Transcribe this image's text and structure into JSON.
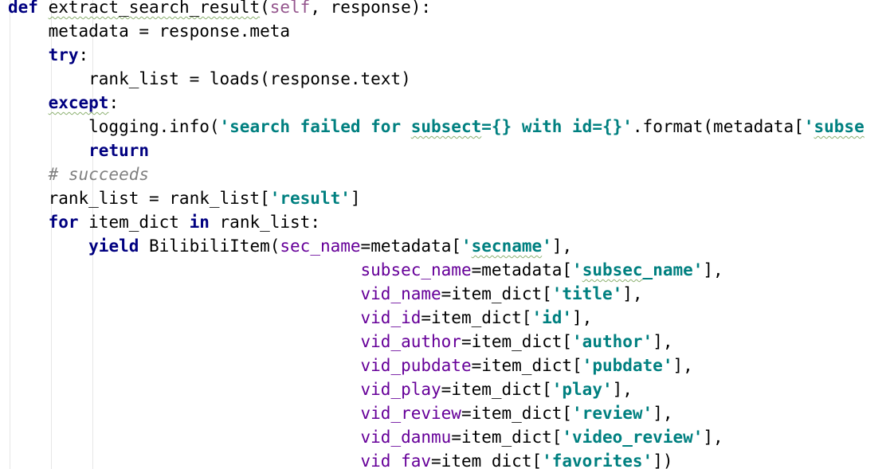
{
  "editor": {
    "language": "Python",
    "colors": {
      "keyword": "#000080",
      "self": "#94558d",
      "kwarg": "#660099",
      "string": "#008080",
      "comment": "#808080",
      "background": "#ffffff"
    },
    "lines": [
      [
        {
          "t": "def ",
          "c": "kw"
        },
        {
          "t": "extract_search_result",
          "c": "squig"
        },
        {
          "t": "("
        },
        {
          "t": "self",
          "c": "self"
        },
        {
          "t": ", response):"
        }
      ],
      [
        {
          "t": "    metadata = response.meta"
        }
      ],
      [
        {
          "t": "    "
        },
        {
          "t": "try",
          "c": "kw"
        },
        {
          "t": ":"
        }
      ],
      [
        {
          "t": "        rank_list = loads(response.text)"
        }
      ],
      [
        {
          "t": "    "
        },
        {
          "t": "except",
          "c": "kw squig"
        },
        {
          "t": ":"
        }
      ],
      [
        {
          "t": "        logging.info("
        },
        {
          "t": "'search failed for ",
          "c": "str"
        },
        {
          "t": "subsect",
          "c": "str squig"
        },
        {
          "t": "={} with id={}'",
          "c": "str"
        },
        {
          "t": ".format(metadata["
        },
        {
          "t": "'",
          "c": "str"
        },
        {
          "t": "subse",
          "c": "str squig"
        }
      ],
      [
        {
          "t": "        "
        },
        {
          "t": "return",
          "c": "kw"
        }
      ],
      [
        {
          "t": "    "
        },
        {
          "t": "# succeeds",
          "c": "cmt"
        }
      ],
      [
        {
          "t": "    rank_list = rank_list["
        },
        {
          "t": "'result'",
          "c": "str"
        },
        {
          "t": "]"
        }
      ],
      [
        {
          "t": "    "
        },
        {
          "t": "for",
          "c": "kw"
        },
        {
          "t": " item_dict "
        },
        {
          "t": "in",
          "c": "kw"
        },
        {
          "t": " rank_list:"
        }
      ],
      [
        {
          "t": "        "
        },
        {
          "t": "yield",
          "c": "kw"
        },
        {
          "t": " BilibiliItem("
        },
        {
          "t": "sec_name",
          "c": "param"
        },
        {
          "t": "=metadata["
        },
        {
          "t": "'",
          "c": "str"
        },
        {
          "t": "secname",
          "c": "str squig"
        },
        {
          "t": "'",
          "c": "str"
        },
        {
          "t": "],"
        }
      ],
      [
        {
          "t": "                                   "
        },
        {
          "t": "subsec_name",
          "c": "param"
        },
        {
          "t": "=metadata["
        },
        {
          "t": "'",
          "c": "str"
        },
        {
          "t": "subsec",
          "c": "str squig"
        },
        {
          "t": "_name'",
          "c": "str"
        },
        {
          "t": "],"
        }
      ],
      [
        {
          "t": "                                   "
        },
        {
          "t": "vid_name",
          "c": "param"
        },
        {
          "t": "=item_dict["
        },
        {
          "t": "'title'",
          "c": "str"
        },
        {
          "t": "],"
        }
      ],
      [
        {
          "t": "                                   "
        },
        {
          "t": "vid_id",
          "c": "param"
        },
        {
          "t": "=item_dict["
        },
        {
          "t": "'id'",
          "c": "str"
        },
        {
          "t": "],"
        }
      ],
      [
        {
          "t": "                                   "
        },
        {
          "t": "vid_author",
          "c": "param"
        },
        {
          "t": "=item_dict["
        },
        {
          "t": "'author'",
          "c": "str"
        },
        {
          "t": "],"
        }
      ],
      [
        {
          "t": "                                   "
        },
        {
          "t": "vid_pubdate",
          "c": "param"
        },
        {
          "t": "=item_dict["
        },
        {
          "t": "'pubdate'",
          "c": "str"
        },
        {
          "t": "],"
        }
      ],
      [
        {
          "t": "                                   "
        },
        {
          "t": "vid_play",
          "c": "param"
        },
        {
          "t": "=item_dict["
        },
        {
          "t": "'play'",
          "c": "str"
        },
        {
          "t": "],"
        }
      ],
      [
        {
          "t": "                                   "
        },
        {
          "t": "vid_review",
          "c": "param"
        },
        {
          "t": "=item_dict["
        },
        {
          "t": "'review'",
          "c": "str"
        },
        {
          "t": "],"
        }
      ],
      [
        {
          "t": "                                   "
        },
        {
          "t": "vid_danmu",
          "c": "param"
        },
        {
          "t": "=item_dict["
        },
        {
          "t": "'video_review'",
          "c": "str"
        },
        {
          "t": "],"
        }
      ],
      [
        {
          "t": "                                   "
        },
        {
          "t": "vid_fav",
          "c": "param"
        },
        {
          "t": "=item_dict["
        },
        {
          "t": "'favorites'",
          "c": "str"
        },
        {
          "t": "])"
        }
      ]
    ]
  }
}
